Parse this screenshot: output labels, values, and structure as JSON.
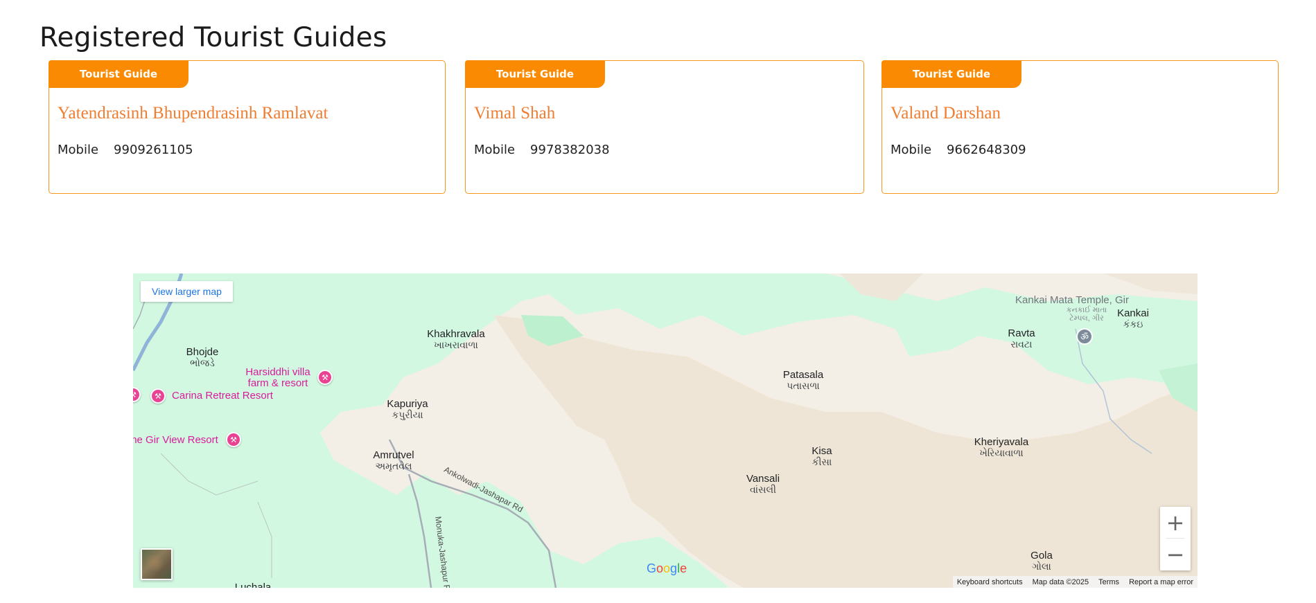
{
  "page": {
    "title": "Registered Tourist Guides"
  },
  "guides": [
    {
      "badge": "Tourist Guide",
      "name": "Yatendrasinh Bhupendrasinh Ramlavat",
      "mobile_label": "Mobile",
      "mobile": "9909261105"
    },
    {
      "badge": "Tourist Guide",
      "name": "Vimal Shah",
      "mobile_label": "Mobile",
      "mobile": "9978382038"
    },
    {
      "badge": "Tourist Guide",
      "name": "Valand Darshan",
      "mobile_label": "Mobile",
      "mobile": "9662648309"
    }
  ],
  "map": {
    "view_larger": "View larger map",
    "zoom_in": "+",
    "zoom_out": "−",
    "google": [
      "G",
      "o",
      "o",
      "g",
      "l",
      "e"
    ],
    "footer": {
      "shortcuts": "Keyboard shortcuts",
      "data": "Map data ©2025",
      "terms": "Terms",
      "report": "Report a map error"
    },
    "places": {
      "khakhravala": {
        "en": "Khakhravala",
        "gu": "ખાખરાવાળા"
      },
      "bhojde": {
        "en": "Bhojde",
        "gu": "ભોજડે"
      },
      "kapuriya": {
        "en": "Kapuriya",
        "gu": "કપુરીયા"
      },
      "amrutvel": {
        "en": "Amrutvel",
        "gu": "અમૃતવેલ"
      },
      "patasala": {
        "en": "Patasala",
        "gu": "પતાસળા"
      },
      "kisa": {
        "en": "Kisa",
        "gu": "કીસા"
      },
      "vansali": {
        "en": "Vansali",
        "gu": "વાંસલી"
      },
      "ravta": {
        "en": "Ravta",
        "gu": "રાવટા"
      },
      "kankai": {
        "en": "Kankai",
        "gu": "કંકઇ"
      },
      "kheriyavala": {
        "en": "Kheriyavala",
        "gu": "ખેરિયાવાળા"
      },
      "gola": {
        "en": "Gola",
        "gu": "ગોલા"
      },
      "luchala": {
        "en": "Luchala",
        "gu": ""
      },
      "temple": {
        "en": "Kankai Mata Temple, Gir",
        "gu1": "કનકાઈ માતા",
        "gu2": "ટેમ્પલ, ગીર"
      },
      "harsiddhi": {
        "en1": "Harsiddhi villa",
        "en2": "farm & resort"
      },
      "carina": {
        "en": "Carina Retreat Resort"
      },
      "girview": {
        "en": "he Gir View Resort"
      }
    },
    "roads": {
      "ankolwadi": "Ankolwadi-Jashapar Rd",
      "monuka": "Monuka-Jashapur Rd"
    },
    "colors": {
      "forest": "#d3f8e2",
      "land": "#f4efe6",
      "sanctuary": "#efe5d6",
      "road": "#9aa3ad",
      "river": "#a9c7e6"
    }
  }
}
